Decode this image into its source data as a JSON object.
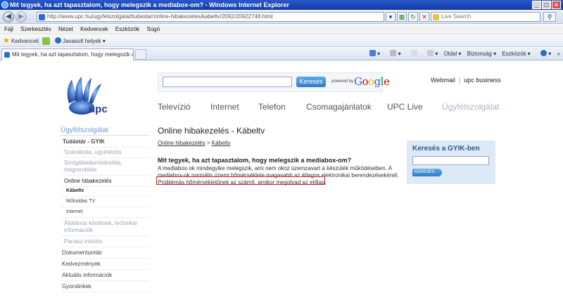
{
  "window": {
    "title": "Mit tegyek, ha azt tapasztalom, hogy melegszik a mediabox-om? - Windows Internet Explorer"
  },
  "address": {
    "url": "http://www.upc.hu/ugyfelszolgalat/tudastar/online-hibakezeles/kabeltv/2092/20922748.html",
    "search_placeholder": "Live Search"
  },
  "menu": [
    "Fájl",
    "Szerkesztés",
    "Nézet",
    "Kedvencek",
    "Eszközök",
    "Súgó"
  ],
  "favorites": {
    "label": "Kedvencek",
    "suggested": "Javasolt helyek ▾"
  },
  "tab": {
    "title": "Mit tegyek, ha azt tapasztalom, hogy melegszik a med..."
  },
  "commandbar": {
    "page": "Oldal ▾",
    "safety": "Biztonság ▾",
    "tools": "Eszközök ▾"
  },
  "site": {
    "logo_text": "upc",
    "search_button": "Keresés",
    "powered_by": "powered by",
    "google": [
      "G",
      "o",
      "o",
      "g",
      "l",
      "e"
    ],
    "webmail": "Webmail",
    "business": "upc business",
    "nav": [
      "Televízió",
      "Internet",
      "Telefon",
      "Csomagajánlatok",
      "UPC Live",
      "Ügyfélszolgálat"
    ]
  },
  "sidebar": {
    "title": "Ügyfélszolgálat",
    "items": [
      "Tudástár - GYIK",
      "Számlázás, ügyintézés",
      "Szolgáltatásmódosítás, megrendelés",
      "Online hibakezelés",
      "Kábeltv",
      "Műholdas TV",
      "Internet",
      "Általános kérdések, technikai információk",
      "Panasz intézés",
      "Dokumentumtár",
      "Kedvezmények",
      "Aktuális információk",
      "Gyorslinkek"
    ]
  },
  "article": {
    "heading": "Online hibakezelés - Kábeltv",
    "breadcrumb_parent": "Online hibakezelés",
    "breadcrumb_sep": " > ",
    "breadcrumb_current": "Kábeltv",
    "question": "Mit tegyek, ha azt tapasztalom, hogy melegszik a mediabox-om?",
    "answer_1": "A mediabox-ok mindegyike melegszik, ami nem okoz üzemzavart a készülék működésében. A mediabox-ok normális üzemi hőmérséklete magasabb az átlagos elektronikai berendezésekénél.",
    "answer_2": "Problémás hőmérsékletűnek az számít, amikor megolvad az előlap."
  },
  "gyik": {
    "title": "Keresés a GYIK-ben",
    "button": "KERESÉS"
  },
  "colors": {
    "brand_blue": "#2a3f8c",
    "accent": "#6a9ad0",
    "highlight": "#d9252b"
  }
}
